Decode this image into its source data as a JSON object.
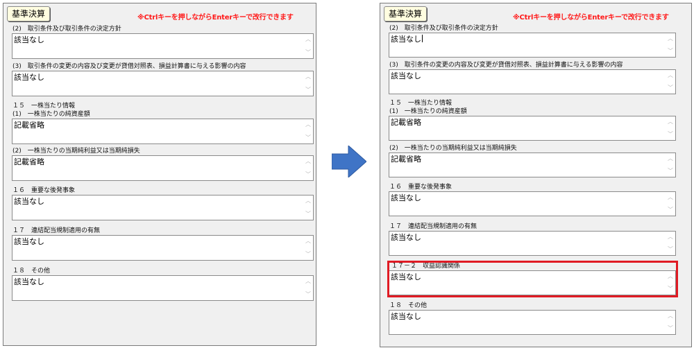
{
  "colors": {
    "note": "#ff1a1a",
    "highlight": "#e01b24",
    "arrow": "#3f74c6"
  },
  "left": {
    "button": "基準決算",
    "note": "※Ctrlキーを押しながらEnterキーで改行できます",
    "sec1_label": "(2)　取引条件及び取引条件の決定方針",
    "sec1_value": "該当なし",
    "sec2_label": "(3)　取引条件の変更の内容及び変更が貸借対照表、損益計算書に与える影響の内容",
    "sec2_value": "該当なし",
    "sec3_heading": "１５　一株当たり情報",
    "sec3_label": "(1)　一株当たりの純資産額",
    "sec3_value": "記載省略",
    "sec4_label": "(2)　一株当たりの当期純利益又は当期純損失",
    "sec4_value": "記載省略",
    "sec5_label": "１６　重要な後発事象",
    "sec5_value": "該当なし",
    "sec6_label": "１７　連結配当規制適用の有無",
    "sec6_value": "該当なし",
    "sec7_label": "１８　その他",
    "sec7_value": "該当なし"
  },
  "right": {
    "button": "基準決算",
    "note": "※Ctrlキーを押しながらEnterキーで改行できます",
    "sec1_label": "(2)　取引条件及び取引条件の決定方針",
    "sec1_value": "該当なし",
    "sec2_label": "(3)　取引条件の変更の内容及び変更が貸借対照表、損益計算書に与える影響の内容",
    "sec2_value": "該当なし",
    "sec3_heading": "１５　一株当たり情報",
    "sec3_label": "(1)　一株当たりの純資産額",
    "sec3_value": "記載省略",
    "sec4_label": "(2)　一株当たりの当期純利益又は当期純損失",
    "sec4_value": "記載省略",
    "sec5_label": "１６　重要な後発事象",
    "sec5_value": "該当なし",
    "sec6_label": "１７　連結配当規制適用の有無",
    "sec6_value": "該当なし",
    "sec_new_label": "１７－２　収益認識関係",
    "sec_new_value": "該当なし",
    "sec7_label": "１８　その他",
    "sec7_value": "該当なし"
  }
}
